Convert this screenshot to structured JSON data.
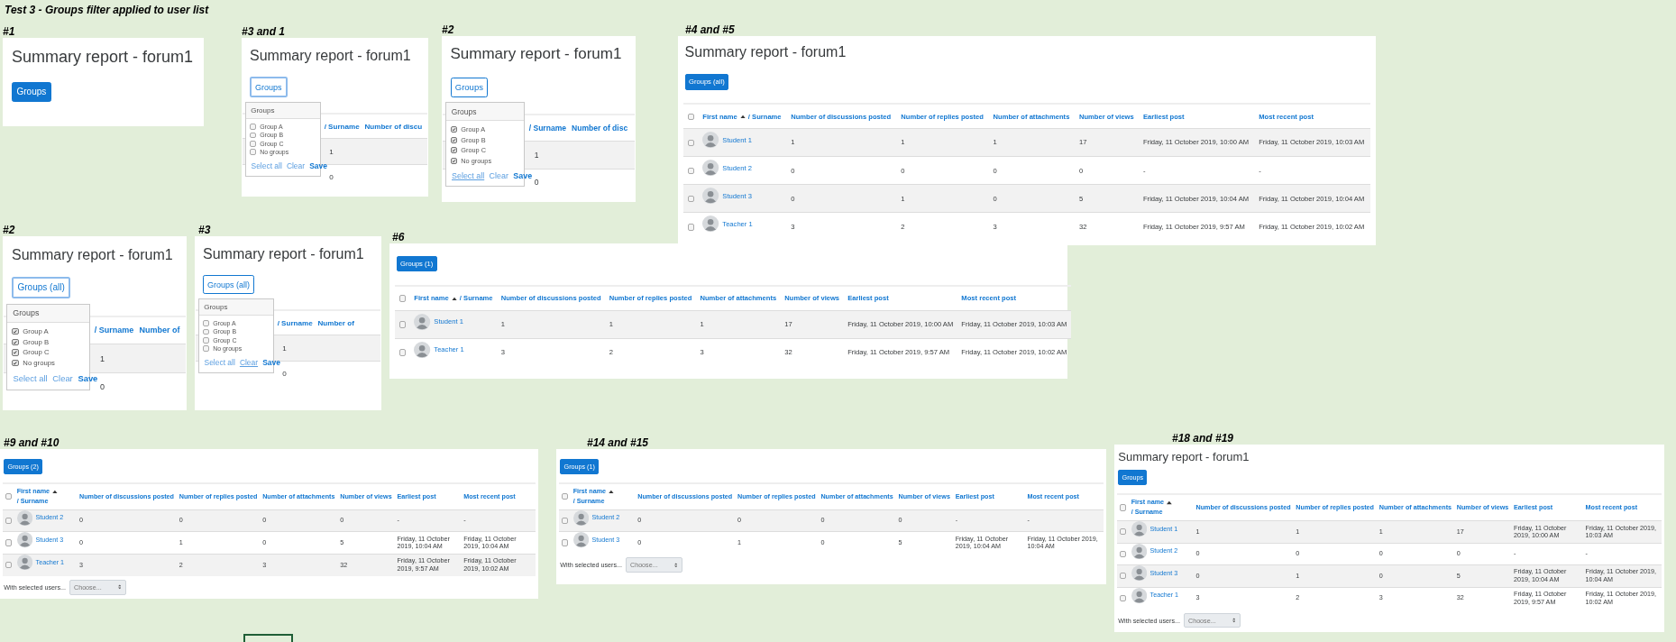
{
  "page_title": "Test 3 - Groups filter applied to user list",
  "panels": [
    {
      "label": "#1",
      "title": "Summary report - forum1",
      "groups_button": {
        "label": "Groups",
        "kind": "filled",
        "focused": false
      }
    },
    {
      "label": "#3 and 1",
      "title": "Summary report - forum1",
      "groups_button": {
        "label": "Groups",
        "kind": "outline",
        "focused": true
      },
      "dropdown": {
        "heading": "Groups",
        "options": [
          {
            "label": "Group A",
            "checked": false
          },
          {
            "label": "Group B",
            "checked": false
          },
          {
            "label": "Group C",
            "checked": false
          },
          {
            "label": "No groups",
            "checked": false
          }
        ],
        "actions": [
          {
            "label": "Select all",
            "kind": "link",
            "focused": false
          },
          {
            "label": "Clear",
            "kind": "link",
            "focused": false
          },
          {
            "label": "Save",
            "kind": "primary",
            "focused": false
          }
        ]
      },
      "partial_table": {
        "columns": [
          "/ Surname",
          "Number of discu"
        ],
        "rows": [
          {
            "value": "1"
          },
          {
            "value": "0"
          }
        ]
      }
    },
    {
      "label": "#2",
      "title": "Summary report - forum1",
      "groups_button": {
        "label": "Groups",
        "kind": "outline",
        "focused": false
      },
      "dropdown": {
        "heading": "Groups",
        "options": [
          {
            "label": "Group A",
            "checked": true
          },
          {
            "label": "Group B",
            "checked": true
          },
          {
            "label": "Group C",
            "checked": true
          },
          {
            "label": "No groups",
            "checked": true
          }
        ],
        "actions": [
          {
            "label": "Select all",
            "kind": "link",
            "focused": true
          },
          {
            "label": "Clear",
            "kind": "link",
            "focused": false
          },
          {
            "label": "Save",
            "kind": "primary",
            "focused": false
          }
        ]
      },
      "partial_table": {
        "columns": [
          "/ Surname",
          "Number of disc"
        ],
        "rows": [
          {
            "value": "1"
          },
          {
            "value": "0"
          }
        ]
      }
    },
    {
      "label": "#4 and #5",
      "title": "Summary report - forum1",
      "groups_button": {
        "label": "Groups (all)",
        "kind": "filled",
        "focused": false
      },
      "table": {
        "select_all_checked": false,
        "columns": [
          {
            "label": "First name",
            "label2": "/ Surname",
            "sorted": true
          },
          {
            "label": "Number of discussions posted"
          },
          {
            "label": "Number of replies posted"
          },
          {
            "label": "Number of attachments"
          },
          {
            "label": "Number of views"
          },
          {
            "label": "Earliest post"
          },
          {
            "label": "Most recent post"
          }
        ],
        "rows": [
          {
            "checked": false,
            "cells": [
              "Student 1",
              "1",
              "1",
              "1",
              "17",
              "Friday, 11 October 2019, 10:00 AM",
              "Friday, 11 October 2019, 10:03 AM"
            ]
          },
          {
            "checked": false,
            "cells": [
              "Student 2",
              "0",
              "0",
              "0",
              "0",
              "-",
              "-"
            ]
          },
          {
            "checked": false,
            "cells": [
              "Student 3",
              "0",
              "1",
              "0",
              "5",
              "Friday, 11 October 2019, 10:04 AM",
              "Friday, 11 October 2019, 10:04 AM"
            ]
          },
          {
            "checked": false,
            "cells": [
              "Teacher 1",
              "3",
              "2",
              "3",
              "32",
              "Friday, 11 October 2019, 9:57 AM",
              "Friday, 11 October 2019, 10:02 AM"
            ]
          }
        ]
      }
    },
    {
      "label": "#2",
      "title": "Summary report - forum1",
      "groups_button": {
        "label": "Groups (all)",
        "kind": "outline",
        "focused": true
      },
      "dropdown": {
        "heading": "Groups",
        "options": [
          {
            "label": "Group A",
            "checked": true
          },
          {
            "label": "Group B",
            "checked": true
          },
          {
            "label": "Group C",
            "checked": true
          },
          {
            "label": "No groups",
            "checked": true
          }
        ],
        "actions": [
          {
            "label": "Select all",
            "kind": "link",
            "focused": false
          },
          {
            "label": "Clear",
            "kind": "link",
            "focused": false
          },
          {
            "label": "Save",
            "kind": "primary",
            "focused": false
          }
        ]
      },
      "partial_table": {
        "columns": [
          "/ Surname",
          "Number of"
        ],
        "rows": [
          {
            "value": "1"
          },
          {
            "value": "0"
          }
        ]
      }
    },
    {
      "label": "#3",
      "title": "Summary report - forum1",
      "groups_button": {
        "label": "Groups (all)",
        "kind": "outline",
        "focused": false
      },
      "dropdown": {
        "heading": "Groups",
        "options": [
          {
            "label": "Group A",
            "checked": false
          },
          {
            "label": "Group B",
            "checked": false
          },
          {
            "label": "Group C",
            "checked": false
          },
          {
            "label": "No groups",
            "checked": false
          }
        ],
        "actions": [
          {
            "label": "Select all",
            "kind": "link",
            "focused": false
          },
          {
            "label": "Clear",
            "kind": "link",
            "focused": true
          },
          {
            "label": "Save",
            "kind": "primary",
            "focused": false
          }
        ]
      },
      "partial_table": {
        "columns": [
          "/ Surname",
          "Number of"
        ],
        "rows": [
          {
            "value": "1"
          },
          {
            "value": "0"
          }
        ]
      }
    },
    {
      "label": "#6",
      "groups_button": {
        "label": "Groups (1)",
        "kind": "filled",
        "focused": false
      },
      "table": {
        "select_all_checked": false,
        "columns": [
          {
            "label": "First name",
            "label2": "/ Surname",
            "sorted": true
          },
          {
            "label": "Number of discussions posted"
          },
          {
            "label": "Number of replies posted"
          },
          {
            "label": "Number of attachments"
          },
          {
            "label": "Number of views"
          },
          {
            "label": "Earliest post"
          },
          {
            "label": "Most recent post"
          }
        ],
        "rows": [
          {
            "checked": false,
            "cells": [
              "Student 1",
              "1",
              "1",
              "1",
              "17",
              "Friday, 11 October 2019, 10:00 AM",
              "Friday, 11 October 2019, 10:03 AM"
            ]
          },
          {
            "checked": false,
            "cells": [
              "Teacher 1",
              "3",
              "2",
              "3",
              "32",
              "Friday, 11 October 2019, 9:57 AM",
              "Friday, 11 October 2019, 10:02 AM"
            ]
          }
        ]
      }
    },
    {
      "label": "#9 and #10",
      "groups_button": {
        "label": "Groups (2)",
        "kind": "filled",
        "focused": false
      },
      "table": {
        "select_all_checked": false,
        "columns": [
          {
            "label": "First name",
            "label2": "/ Surname",
            "sorted": true
          },
          {
            "label": "Number of discussions posted"
          },
          {
            "label": "Number of replies posted"
          },
          {
            "label": "Number of attachments"
          },
          {
            "label": "Number of views"
          },
          {
            "label": "Earliest post"
          },
          {
            "label": "Most recent post"
          }
        ],
        "rows": [
          {
            "checked": false,
            "cells": [
              "Student 2",
              "0",
              "0",
              "0",
              "0",
              "-",
              "-"
            ]
          },
          {
            "checked": false,
            "cells": [
              "Student 3",
              "0",
              "1",
              "0",
              "5",
              "Friday, 11 October 2019, 10:04 AM",
              "Friday, 11 October 2019, 10:04 AM"
            ]
          },
          {
            "checked": false,
            "cells": [
              "Teacher 1",
              "3",
              "2",
              "3",
              "32",
              "Friday, 11 October 2019, 9:57 AM",
              "Friday, 11 October 2019, 10:02 AM"
            ]
          }
        ]
      },
      "bulk_action": {
        "label": "With selected users...",
        "placeholder": "Choose..."
      }
    },
    {
      "label": "#14 and #15",
      "groups_button": {
        "label": "Groups (1)",
        "kind": "filled",
        "focused": false
      },
      "table": {
        "select_all_checked": false,
        "columns": [
          {
            "label": "First name",
            "label2": "/ Surname",
            "sorted": true
          },
          {
            "label": "Number of discussions posted"
          },
          {
            "label": "Number of replies posted"
          },
          {
            "label": "Number of attachments"
          },
          {
            "label": "Number of views"
          },
          {
            "label": "Earliest post"
          },
          {
            "label": "Most recent post"
          }
        ],
        "rows": [
          {
            "checked": false,
            "cells": [
              "Student 2",
              "0",
              "0",
              "0",
              "0",
              "-",
              "-"
            ]
          },
          {
            "checked": false,
            "cells": [
              "Student 3",
              "0",
              "1",
              "0",
              "5",
              "Friday, 11 October 2019, 10:04 AM",
              "Friday, 11 October 2019, 10:04 AM"
            ]
          }
        ]
      },
      "bulk_action": {
        "label": "With selected users...",
        "placeholder": "Choose..."
      }
    },
    {
      "label": "#18 and #19",
      "title": "Summary report - forum1",
      "groups_button": {
        "label": "Groups",
        "kind": "filled",
        "focused": false
      },
      "table": {
        "select_all_checked": false,
        "columns": [
          {
            "label": "First name",
            "label2": "/ Surname",
            "sorted": true
          },
          {
            "label": "Number of discussions posted"
          },
          {
            "label": "Number of replies posted"
          },
          {
            "label": "Number of attachments"
          },
          {
            "label": "Number of views"
          },
          {
            "label": "Earliest post"
          },
          {
            "label": "Most recent post"
          }
        ],
        "rows": [
          {
            "checked": false,
            "cells": [
              "Student 1",
              "1",
              "1",
              "1",
              "17",
              "Friday, 11 October 2019, 10:00 AM",
              "Friday, 11 October 2019, 10:03 AM"
            ]
          },
          {
            "checked": false,
            "cells": [
              "Student 2",
              "0",
              "0",
              "0",
              "0",
              "-",
              "-"
            ]
          },
          {
            "checked": false,
            "cells": [
              "Student 3",
              "0",
              "1",
              "0",
              "5",
              "Friday, 11 October 2019, 10:04 AM",
              "Friday, 11 October 2019, 10:04 AM"
            ]
          },
          {
            "checked": false,
            "cells": [
              "Teacher 1",
              "3",
              "2",
              "3",
              "32",
              "Friday, 11 October 2019, 9:57 AM",
              "Friday, 11 October 2019, 10:02 AM"
            ]
          }
        ]
      },
      "bulk_action": {
        "label": "With selected users...",
        "placeholder": "Choose..."
      }
    }
  ]
}
